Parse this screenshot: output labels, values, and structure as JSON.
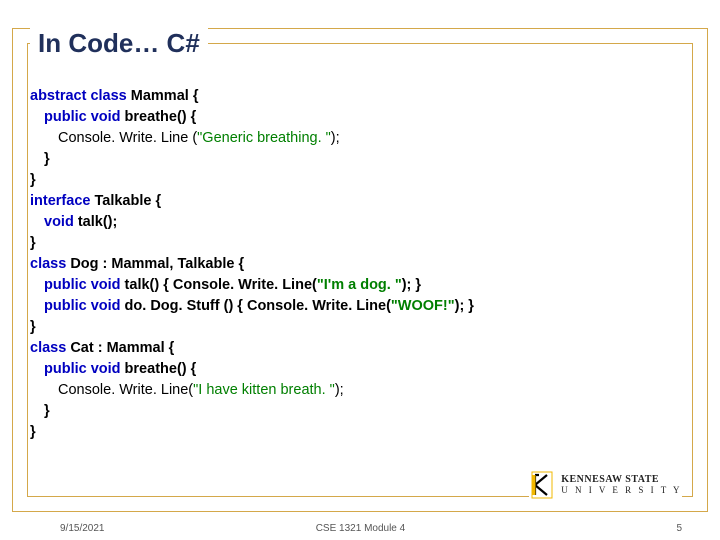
{
  "title": "In Code… C#",
  "code": {
    "l1a": "abstract class",
    "l1b": " Mammal {",
    "l2a": "public void",
    "l2b": " breathe() {",
    "l3a": "Console. Write. Line (",
    "l3b": "\"Generic breathing. \"",
    "l3c": ");",
    "l4": "}",
    "l5": "}",
    "l6a": "interface",
    "l6b": " Talkable {",
    "l7a": "void",
    "l7b": " talk();",
    "l8": "}",
    "l9a": "class",
    "l9b": " Dog : Mammal, Talkable {",
    "l10a": "public void",
    "l10b": " talk() { Console. Write. Line(",
    "l10c": "\"I'm a dog. \"",
    "l10d": "); }",
    "l11a": "public void",
    "l11b": " do. Dog. Stuff () { Console. Write. Line(",
    "l11c": "\"WOOF!\"",
    "l11d": "); }",
    "l12": "}",
    "l13a": "class",
    "l13b": " Cat : Mammal {",
    "l14a": "public void",
    "l14b": " breathe() {",
    "l15a": "Console. Write. Line(",
    "l15b": "\"I have kitten breath. \"",
    "l15c": ");",
    "l16": "}",
    "l17": "}"
  },
  "footer": {
    "date": "9/15/2021",
    "module": "CSE 1321 Module 4",
    "page": "5"
  },
  "logo": {
    "line1": "KENNESAW STATE",
    "line2": "U N I V E R S I T Y"
  }
}
